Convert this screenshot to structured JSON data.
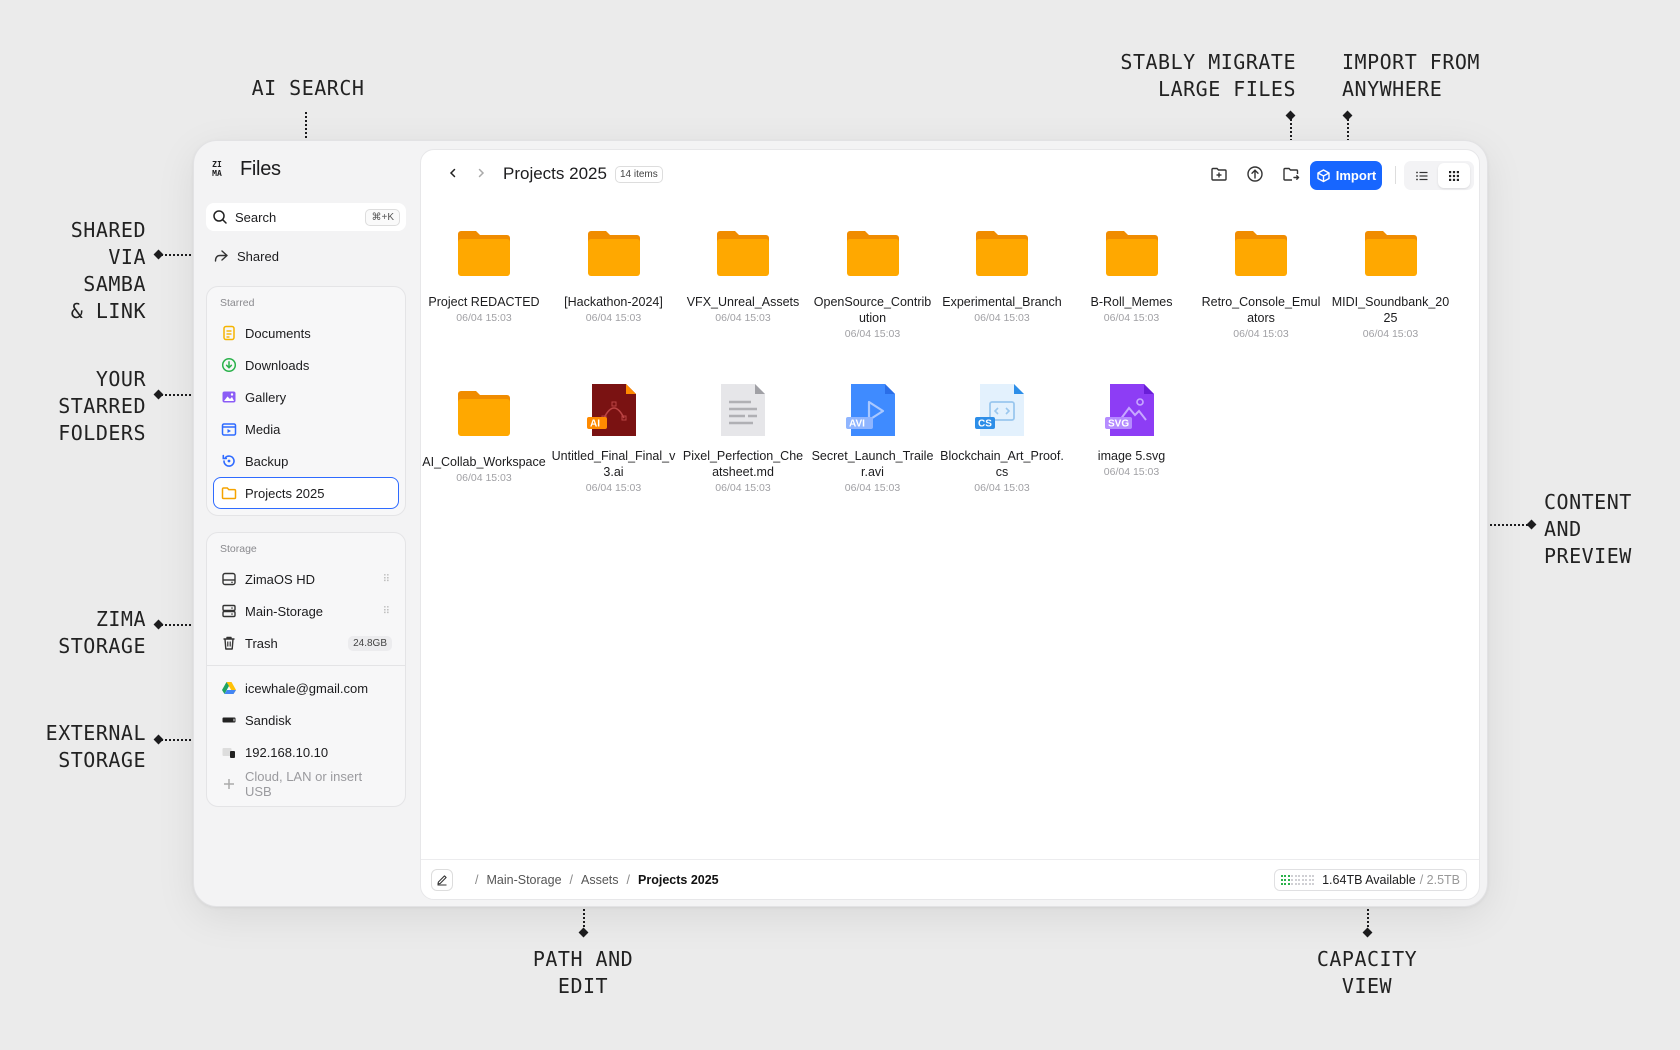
{
  "annotations": {
    "ai_search": [
      "AI SEARCH"
    ],
    "shared": [
      "SHARED",
      "VIA",
      "SAMBA",
      "& LINK"
    ],
    "starred": [
      "YOUR",
      "STARRED",
      "FOLDERS"
    ],
    "zima_storage": [
      "ZIMA",
      "STORAGE"
    ],
    "external_storage": [
      "EXTERNAL",
      "STORAGE"
    ],
    "migrate": [
      "STABLY MIGRATE",
      "LARGE FILES"
    ],
    "import_anywhere": [
      "IMPORT FROM",
      "ANYWHERE"
    ],
    "content": [
      "CONTENT",
      "AND",
      "PREVIEW"
    ],
    "path": [
      "PATH AND",
      "EDIT"
    ],
    "capacity": [
      "CAPACITY",
      "VIEW"
    ]
  },
  "app": {
    "logo_text_top": "ZI",
    "logo_text_bottom": "MA",
    "title": "Files"
  },
  "sidebar": {
    "search_label": "Search",
    "search_shortcut": "⌘+K",
    "shared_label": "Shared",
    "starred_title": "Starred",
    "starred": [
      {
        "label": "Documents",
        "icon": "document-icon",
        "color": "#f5b400"
      },
      {
        "label": "Downloads",
        "icon": "download-icon",
        "color": "#2bb24c"
      },
      {
        "label": "Gallery",
        "icon": "gallery-icon",
        "color": "#8b5cf6"
      },
      {
        "label": "Media",
        "icon": "media-icon",
        "color": "#2f6bff"
      },
      {
        "label": "Backup",
        "icon": "backup-icon",
        "color": "#2f6bff"
      },
      {
        "label": "Projects 2025",
        "icon": "folder-icon",
        "color": "#f5a300"
      }
    ],
    "storage_title": "Storage",
    "storage": [
      {
        "label": "ZimaOS HD",
        "trail": "⠿"
      },
      {
        "label": "Main-Storage",
        "trail": "⠿"
      },
      {
        "label": "Trash",
        "badge": "24.8GB"
      }
    ],
    "external": [
      {
        "label": "icewhale@gmail.com"
      },
      {
        "label": "Sandisk"
      },
      {
        "label": "192.168.10.10"
      },
      {
        "label": "Cloud, LAN or insert USB"
      }
    ]
  },
  "toolbar": {
    "folder_title": "Projects 2025",
    "item_count": "14 items",
    "import_label": "Import"
  },
  "files": [
    {
      "name": "Project REDACTED",
      "date": "06/04 15:03",
      "type": "folder"
    },
    {
      "name": "[Hackathon-2024]",
      "date": "06/04 15:03",
      "type": "folder"
    },
    {
      "name": "VFX_Unreal_Assets",
      "date": "06/04 15:03",
      "type": "folder"
    },
    {
      "name": "OpenSource_Contribution",
      "date": "06/04 15:03",
      "type": "folder"
    },
    {
      "name": "Experimental_Branch",
      "date": "06/04 15:03",
      "type": "folder"
    },
    {
      "name": "B-Roll_Memes",
      "date": "06/04 15:03",
      "type": "folder"
    },
    {
      "name": "Retro_Console_Emulators",
      "date": "06/04 15:03",
      "type": "folder"
    },
    {
      "name": "MIDI_Soundbank_2025",
      "date": "06/04 15:03",
      "type": "folder"
    },
    {
      "name": "AI_Collab_Workspace",
      "date": "06/04 15:03",
      "type": "folder"
    },
    {
      "name": "Untitled_Final_Final_v3.ai",
      "date": "06/04 15:03",
      "type": "ai",
      "tag": "AI"
    },
    {
      "name": "Pixel_Perfection_Cheatsheet.md",
      "date": "06/04 15:03",
      "type": "md"
    },
    {
      "name": "Secret_Launch_Trailer.avi",
      "date": "06/04 15:03",
      "type": "avi",
      "tag": "AVI"
    },
    {
      "name": "Blockchain_Art_Proof.cs",
      "date": "06/04 15:03",
      "type": "cs",
      "tag": "CS"
    },
    {
      "name": "image 5.svg",
      "date": "06/04 15:03",
      "type": "svg",
      "tag": "SVG"
    }
  ],
  "path": {
    "root_sep": "/",
    "segments": [
      "Main-Storage",
      "Assets"
    ],
    "current": "Projects 2025"
  },
  "capacity": {
    "available": "1.64TB Available",
    "total": "/ 2.5TB",
    "used_fraction": 0.34
  },
  "colors": {
    "accent": "#1766ff",
    "folder": "#ffa800",
    "success": "#2bb24c"
  }
}
